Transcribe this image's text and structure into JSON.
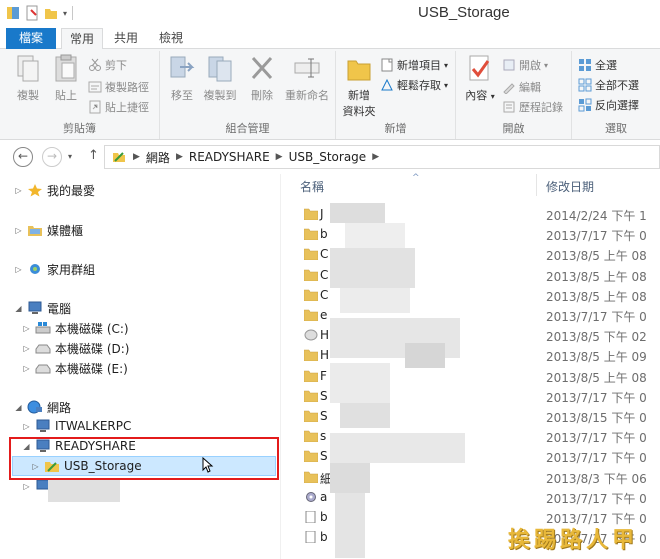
{
  "window": {
    "title": "USB_Storage"
  },
  "ribbon_tabs": {
    "file": "檔案",
    "home": "常用",
    "share": "共用",
    "view": "檢視"
  },
  "ribbon": {
    "clipboard": {
      "label": "剪貼簿",
      "copy": "複製",
      "paste": "貼上",
      "cut": "剪下",
      "copy_path": "複製路徑",
      "paste_shortcut": "貼上捷徑"
    },
    "organize": {
      "label": "組合管理",
      "move_to": "移至",
      "copy_to": "複製到",
      "delete": "刪除",
      "rename": "重新命名"
    },
    "new": {
      "label": "新增",
      "new_folder_line1": "新增",
      "new_folder_line2": "資料夾",
      "new_item": "新增項目",
      "easy_access": "輕鬆存取"
    },
    "open": {
      "label": "開啟",
      "properties": "內容",
      "open": "開啟",
      "edit": "編輯",
      "history": "歷程記錄"
    },
    "select": {
      "label": "選取",
      "select_all": "全選",
      "select_none": "全部不選",
      "invert": "反向選擇"
    }
  },
  "address": {
    "crumbs": [
      "網路",
      "READYSHARE",
      "USB_Storage"
    ]
  },
  "nav": {
    "favorites": "我的最愛",
    "libraries": "媒體櫃",
    "homegroup": "家用群組",
    "computer": "電腦",
    "drive_c": "本機磁碟 (C:)",
    "drive_d": "本機磁碟 (D:)",
    "drive_e": "本機磁碟 (E:)",
    "network": "網路",
    "itwalkerpc": "ITWALKERPC",
    "readyshare": "READYSHARE",
    "usb_storage": "USB_Storage"
  },
  "columns": {
    "name": "名稱",
    "modified": "修改日期"
  },
  "files": [
    {
      "initial": "J",
      "date": "2014/2/24 下午 1",
      "icon": "folder"
    },
    {
      "initial": "b",
      "date": "2013/7/17 下午 0",
      "icon": "folder"
    },
    {
      "initial": "C",
      "date": "2013/8/5 上午 08",
      "icon": "folder"
    },
    {
      "initial": "C",
      "date": "2013/8/5 上午 08",
      "icon": "folder"
    },
    {
      "initial": "C",
      "date": "2013/8/5 上午 08",
      "icon": "folder"
    },
    {
      "initial": "e",
      "date": "2013/7/17 下午 0",
      "icon": "folder"
    },
    {
      "initial": "H",
      "date": "2013/8/5 下午 02",
      "icon": "disc"
    },
    {
      "initial": "H",
      "date": "2013/8/5 上午 09",
      "icon": "folder"
    },
    {
      "initial": "F",
      "date": "2013/8/5 上午 08",
      "icon": "folder"
    },
    {
      "initial": "S",
      "date": "2013/7/17 下午 0",
      "icon": "folder"
    },
    {
      "initial": "S",
      "date": "2013/8/15 下午 0",
      "icon": "folder"
    },
    {
      "initial": "s",
      "date": "2013/7/17 下午 0",
      "icon": "folder"
    },
    {
      "initial": "S",
      "date": "2013/7/17 下午 0",
      "icon": "folder"
    },
    {
      "initial": "細",
      "date": "2013/8/3 下午 06",
      "icon": "folder"
    },
    {
      "initial": "a",
      "date": "2013/7/17 下午 0",
      "icon": "gear"
    },
    {
      "initial": "b",
      "date": "2013/7/17 下午 0",
      "icon": "file"
    },
    {
      "initial": "b",
      "date": "2013/7/17 下午 0",
      "icon": "file"
    }
  ],
  "watermark": "挨踢路人甲",
  "colors": {
    "accent": "#1979ca",
    "folder": "#e8c15a",
    "highlight": "#e31b1b",
    "selected": "#cce8ff"
  }
}
